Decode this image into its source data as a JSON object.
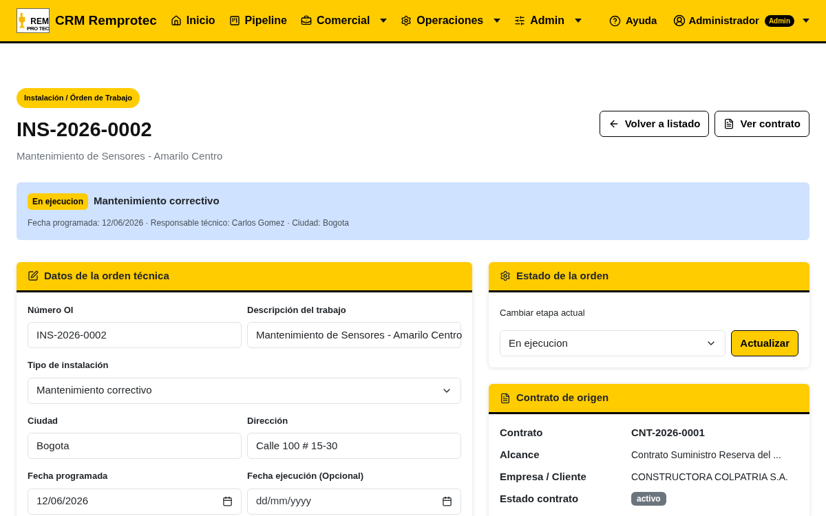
{
  "navbar": {
    "brand": "CRM Remprotec",
    "logo": {
      "line1": "REM",
      "line2": "PRO TEC"
    },
    "items": [
      {
        "label": "Inicio",
        "dropdown": false
      },
      {
        "label": "Pipeline",
        "dropdown": false
      },
      {
        "label": "Comercial",
        "dropdown": true
      },
      {
        "label": "Operaciones",
        "dropdown": true
      },
      {
        "label": "Admin",
        "dropdown": true
      }
    ],
    "help": "Ayuda",
    "user": {
      "name": "Administrador",
      "badge": "Admin",
      "dropdown": true
    }
  },
  "header": {
    "breadcrumb": "Instalación / Órden de Trabajo",
    "title": "INS-2026-0002",
    "subtitle": "Mantenimiento de Sensores - Amarilo Centro",
    "buttons": [
      {
        "label": "Volver a listado"
      },
      {
        "label": "Ver contrato"
      }
    ]
  },
  "status_banner": {
    "badge": "En ejecucion",
    "title": "Mantenimiento correctivo",
    "details": "Fecha programada: 12/06/2026 · Responsable técnico: Carlos Gomez · Ciudad: Bogota"
  },
  "order_form": {
    "title": "Datos de la orden técnica",
    "rows": [
      [
        {
          "label": "Número OI",
          "kind": "text",
          "value": "INS-2026-0002"
        },
        {
          "label": "Descripción del trabajo",
          "kind": "text",
          "value": "Mantenimiento de Sensores - Amarilo Centro"
        }
      ],
      [
        {
          "label": "Tipo de instalación",
          "kind": "select",
          "value": "Mantenimiento correctivo"
        }
      ],
      [
        {
          "label": "Ciudad",
          "kind": "text",
          "value": "Bogota"
        },
        {
          "label": "Dirección",
          "kind": "text",
          "value": "Calle 100 # 15-30"
        }
      ],
      [
        {
          "label": "Fecha programada",
          "kind": "date",
          "value": "12/06/2026"
        },
        {
          "label": "Fecha ejecución (Opcional)",
          "kind": "date",
          "placeholder": "dd/mm/yyyy"
        }
      ]
    ]
  },
  "order_status": {
    "title": "Estado de la orden",
    "label": "Cambiar etapa actual",
    "value": "En ejecucion",
    "button": "Actualizar"
  },
  "contract": {
    "title": "Contrato de origen",
    "rows": [
      {
        "label": "Contrato",
        "value": "CNT-2026-0001",
        "kind": "bold"
      },
      {
        "label": "Alcance",
        "value": "Contrato Suministro Reserva del ...",
        "kind": "text"
      },
      {
        "label": "Empresa / Cliente",
        "value": "CONSTRUCTORA COLPATRIA S.A.",
        "kind": "text"
      },
      {
        "label": "Estado contrato",
        "value": "activo",
        "kind": "badge"
      }
    ]
  }
}
